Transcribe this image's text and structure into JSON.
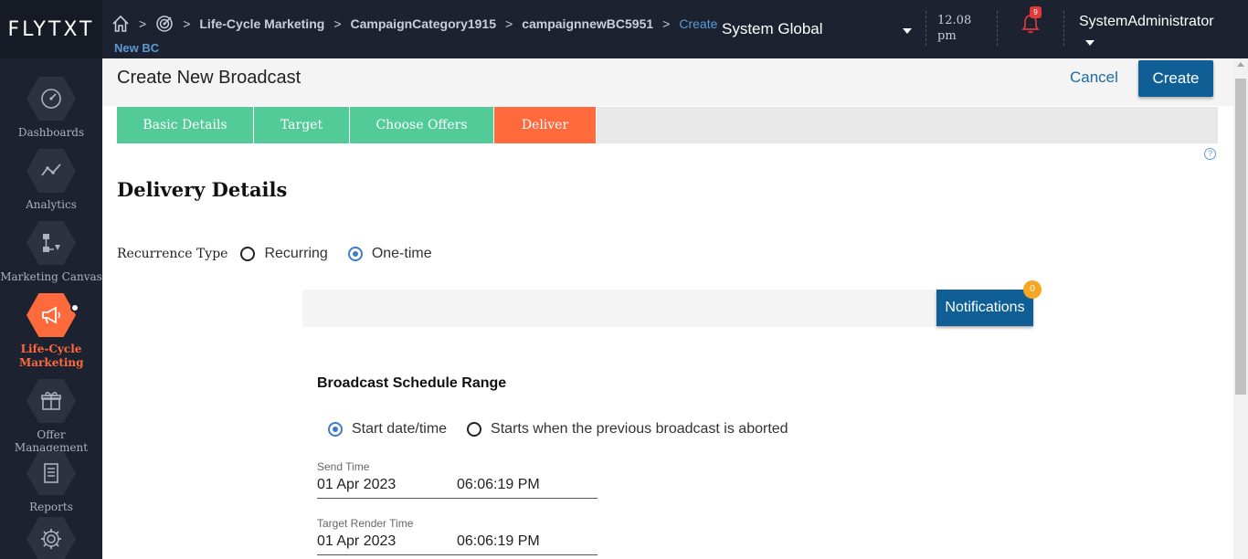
{
  "header": {
    "logo": "FLYTXT",
    "breadcrumb": [
      "Life-Cycle Marketing",
      "CampaignCategory1915",
      "campaignnewBC5951"
    ],
    "breadcrumb_current": "Create",
    "breadcrumb_current_line2": "New BC",
    "org_select": "System Global",
    "time_value": "12.08",
    "time_period": "pm",
    "notification_count": "9",
    "user_name": "SystemAdministrator"
  },
  "sidebar": {
    "items": [
      {
        "label": "Dashboards",
        "icon": "dashboard-gauge-icon"
      },
      {
        "label": "Analytics",
        "icon": "analytics-line-icon"
      },
      {
        "label": "Marketing Canvas",
        "icon": "canvas-flow-icon"
      },
      {
        "label": "Life-Cycle Marketing",
        "icon": "megaphone-icon",
        "active": true
      },
      {
        "label": "Offer Management",
        "icon": "gift-icon"
      },
      {
        "label": "Reports",
        "icon": "report-doc-icon"
      },
      {
        "label": "",
        "icon": "settings-gear-icon"
      }
    ]
  },
  "page": {
    "title": "Create New Broadcast",
    "cancel_label": "Cancel",
    "create_label": "Create",
    "steps": [
      "Basic Details",
      "Target",
      "Choose Offers",
      "Deliver"
    ],
    "active_step": "Deliver",
    "help_glyph": "?",
    "section_title": "Delivery Details",
    "recurrence_label": "Recurrence Type",
    "recurrence_options": [
      "Recurring",
      "One-time"
    ],
    "recurrence_selected": "One-time",
    "notifications_label": "Notifications",
    "notifications_count": "0",
    "schedule_title": "Broadcast Schedule Range",
    "schedule_options": [
      "Start date/time",
      "Starts when the previous broadcast is aborted"
    ],
    "schedule_selected": "Start date/time",
    "send_time": {
      "label": "Send Time",
      "date": "01 Apr 2023",
      "time": "06:06:19 PM"
    },
    "target_render_time": {
      "label": "Target Render Time",
      "date": "01 Apr 2023",
      "time": "06:06:19 PM"
    }
  },
  "colors": {
    "header_bg": "#1c2230",
    "accent_orange": "#ff6a3d",
    "step_green": "#52cb98",
    "primary_blue": "#0f5f96",
    "badge_orange": "#f5a623",
    "alert_red": "#e03a3a"
  }
}
